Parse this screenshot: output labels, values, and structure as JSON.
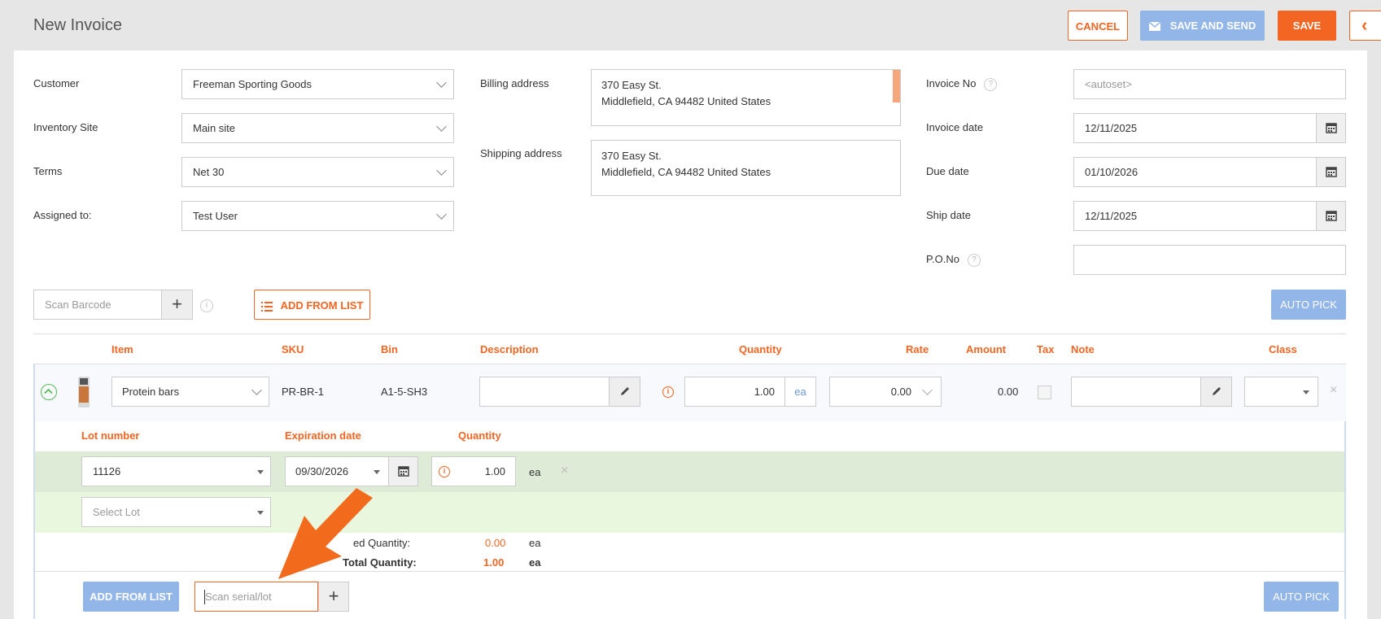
{
  "header": {
    "title": "New Invoice",
    "cancel_label": "CANCEL",
    "save_send_label": "SAVE AND SEND",
    "save_label": "SAVE"
  },
  "form": {
    "customer_label": "Customer",
    "customer_value": "Freeman Sporting Goods",
    "site_label": "Inventory Site",
    "site_value": "Main site",
    "terms_label": "Terms",
    "terms_value": "Net 30",
    "assigned_label": "Assigned to:",
    "assigned_value": "Test User",
    "billing_label": "Billing address",
    "billing_line1": "370 Easy St.",
    "billing_line2": "Middlefield, CA 94482 United States",
    "shipping_label": "Shipping address",
    "shipping_line1": "370 Easy St.",
    "shipping_line2": "Middlefield, CA 94482 United States",
    "invoice_no_label": "Invoice No",
    "invoice_no_placeholder": "<autoset>",
    "invoice_date_label": "Invoice date",
    "invoice_date_value": "12/11/2025",
    "due_date_label": "Due date",
    "due_date_value": "01/10/2026",
    "ship_date_label": "Ship date",
    "ship_date_value": "12/11/2025",
    "po_label": "P.O.No",
    "po_value": ""
  },
  "toolbar": {
    "scan_placeholder": "Scan Barcode",
    "add_from_list_label": "ADD FROM LIST",
    "auto_pick_label": "AUTO PICK"
  },
  "table": {
    "columns": {
      "item": "Item",
      "sku": "SKU",
      "bin": "Bin",
      "description": "Description",
      "quantity": "Quantity",
      "rate": "Rate",
      "amount": "Amount",
      "tax": "Tax",
      "note": "Note",
      "class": "Class"
    },
    "row": {
      "item": "Protein bars",
      "sku": "PR-BR-1",
      "bin": "A1-5-SH3",
      "quantity": "1.00",
      "unit": "ea",
      "rate": "0.00",
      "amount": "0.00"
    }
  },
  "lots": {
    "columns": {
      "lot": "Lot number",
      "expiration": "Expiration date",
      "quantity": "Quantity"
    },
    "row": {
      "lot": "11126",
      "expiration": "09/30/2026",
      "quantity": "1.00",
      "unit": "ea"
    },
    "select_placeholder": "Select Lot",
    "assigned_label": "ed Quantity:",
    "assigned_value": "0.00",
    "assigned_unit": "ea",
    "total_label": "Total Quantity:",
    "total_value": "1.00",
    "total_unit": "ea",
    "add_from_list_label": "ADD FROM LIST",
    "scan_placeholder": "Scan serial/lot",
    "auto_pick_label": "AUTO PICK"
  },
  "colors": {
    "accent": "#f26522",
    "button_blue": "#93b6e8"
  }
}
